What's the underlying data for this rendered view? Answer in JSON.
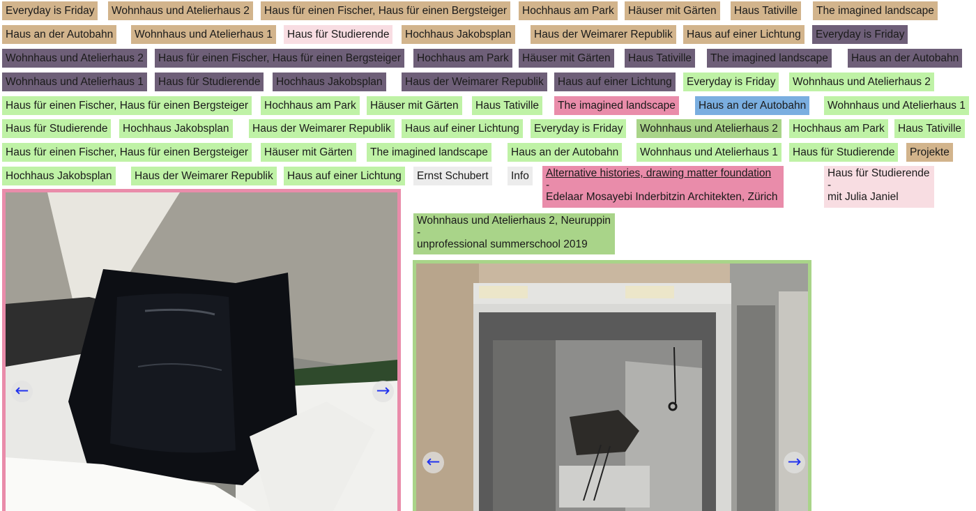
{
  "colors": {
    "tan": "#d2b48c",
    "pale_pink": "#f8dde2",
    "purple": "#6e5f78",
    "light_green": "#bff2a6",
    "rose": "#e98caa",
    "blue": "#7aaee0",
    "green": "#a9d489",
    "gray": "#ececec",
    "arrow_blue": "#2233ee"
  },
  "tags": [
    "Everyday is Friday",
    "Wohnhaus und Atelierhaus 2",
    "Haus für einen Fischer, Haus für einen Bergsteiger",
    "Hochhaus am Park",
    "Häuser mit Gärten",
    "Haus Tativille",
    "The imagined landscape",
    "Haus an der Autobahn",
    "Wohnhaus und Atelierhaus 1",
    "Haus für Studierende",
    "Hochhaus Jakobsplan",
    "Haus der Weimarer Republik",
    "Haus auf einer Lichtung",
    "Everyday is Friday",
    "Wohnhaus und Atelierhaus 2",
    "Haus für einen Fischer, Haus für einen Bergsteiger",
    "Hochhaus am Park",
    "Häuser mit Gärten",
    "Haus Tativille",
    "The imagined landscape",
    "Haus an der Autobahn",
    "Wohnhaus und Atelierhaus 1",
    "Haus für Studierende",
    "Hochhaus Jakobsplan",
    "Haus der Weimarer Republik",
    "Haus auf einer Lichtung",
    "Everyday is Friday",
    "Wohnhaus und Atelierhaus 2",
    "Haus für einen Fischer, Haus für einen Bergsteiger",
    "Hochhaus am Park",
    "Häuser mit Gärten",
    "Haus Tativille",
    "The imagined landscape",
    "Haus an der Autobahn",
    "Wohnhaus und Atelierhaus 1",
    "Haus für Studierende",
    "Hochhaus Jakobsplan",
    "Haus der Weimarer Republik",
    "Haus auf einer Lichtung",
    "Everyday is Friday",
    "Wohnhaus und Atelierhaus 2",
    "Hochhaus am Park",
    "Haus Tativille",
    "Haus für einen Fischer, Haus für einen Bergsteiger",
    "Häuser mit Gärten",
    "The imagined landscape",
    "Haus an der Autobahn",
    "Wohnhaus und Atelierhaus 1",
    "Haus für Studierende",
    "Projekte",
    "Hochhaus Jakobsplan",
    "Haus der Weimarer Republik",
    "Haus auf einer Lichtung",
    "Ernst Schubert",
    "Info"
  ],
  "project_blocks": {
    "left_caption": {
      "title": "Alternative histories, drawing matter foundation",
      "sep": "-",
      "sub": "Edelaar Mosayebi Inderbitzin Architekten, Zürich"
    },
    "right_caption": {
      "title": "Haus für Studierende",
      "sep": "-",
      "sub": "mit Julia Janiel"
    },
    "middle_caption": {
      "title": "Wohnhaus und Atelierhaus 2, Neuruppin",
      "sep": "-",
      "sub": "unprofessional summerschool 2019"
    }
  },
  "slideshows": {
    "left": {
      "prev": "←",
      "next": "→",
      "image": "photo of black lacquered box on white paper"
    },
    "right": {
      "prev": "←",
      "next": "→",
      "image": "photo of black and white model print pinned to wall"
    }
  }
}
